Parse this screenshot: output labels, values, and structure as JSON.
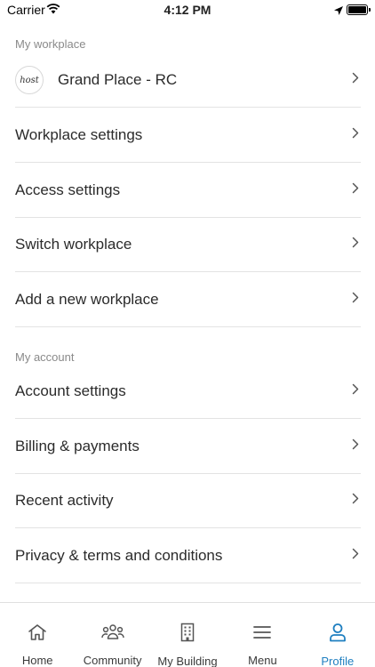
{
  "status_bar": {
    "carrier": "Carrier",
    "time": "4:12 PM"
  },
  "workplace_section": {
    "header": "My workplace",
    "current": {
      "logo_text": "host",
      "name": "Grand Place - RC"
    },
    "items": [
      {
        "label": "Workplace settings"
      },
      {
        "label": "Access settings"
      },
      {
        "label": "Switch workplace"
      },
      {
        "label": "Add a new workplace"
      }
    ]
  },
  "account_section": {
    "header": "My account",
    "items": [
      {
        "label": "Account settings"
      },
      {
        "label": "Billing & payments"
      },
      {
        "label": "Recent activity"
      },
      {
        "label": "Privacy & terms and conditions"
      }
    ]
  },
  "tab_bar": {
    "tabs": [
      {
        "label": "Home",
        "icon": "home-icon"
      },
      {
        "label": "Community",
        "icon": "people-icon"
      },
      {
        "label": "My Building",
        "icon": "building-icon"
      },
      {
        "label": "Menu",
        "icon": "menu-icon"
      },
      {
        "label": "Profile",
        "icon": "profile-icon"
      }
    ],
    "active_color": "#1f7fc0"
  }
}
